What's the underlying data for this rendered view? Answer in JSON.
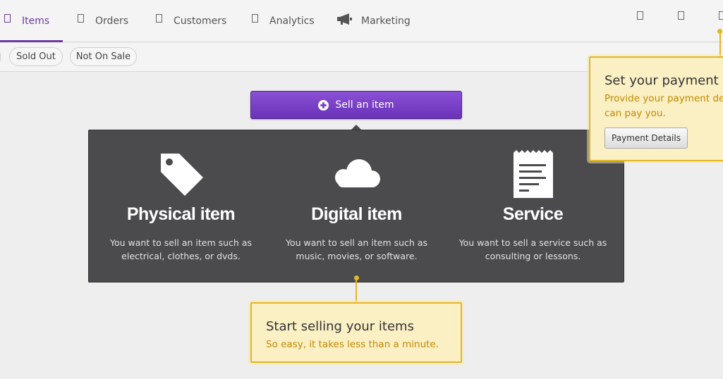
{
  "nav": {
    "tabs": [
      {
        "label": "Items",
        "active": true
      },
      {
        "label": "Orders"
      },
      {
        "label": "Customers"
      },
      {
        "label": "Analytics"
      },
      {
        "label": "Marketing",
        "icon": "megaphone-icon"
      }
    ]
  },
  "filters": [
    "Sold Out",
    "Not On Sale"
  ],
  "sell_button": {
    "label": "Sell an item",
    "icon": "plus-circle-icon"
  },
  "options": [
    {
      "title": "Physical item",
      "desc_line1": "You want to sell an item such as",
      "desc_line2": "electrical, clothes, or dvds.",
      "icon": "tag-icon"
    },
    {
      "title": "Digital item",
      "desc_line1": "You want to sell an item such as",
      "desc_line2": "music, movies, or software.",
      "icon": "cloud-icon"
    },
    {
      "title": "Service",
      "desc_line1": "You want to sell a service such as",
      "desc_line2": "consulting or lessons.",
      "icon": "receipt-icon"
    }
  ],
  "callout_selling": {
    "title": "Start selling your items",
    "text": "So easy, it takes less than a minute."
  },
  "callout_payment": {
    "title": "Set your payment de",
    "text_line1": "Provide your payment det",
    "text_line2": "can pay you.",
    "button": "Payment Details"
  },
  "colors": {
    "accent": "#6a3aa0",
    "button": "#7a42c6",
    "panel": "#4b4a4c",
    "callout_bg": "#fbefc4",
    "callout_border": "#e2b624",
    "callout_text": "#c08a00"
  }
}
